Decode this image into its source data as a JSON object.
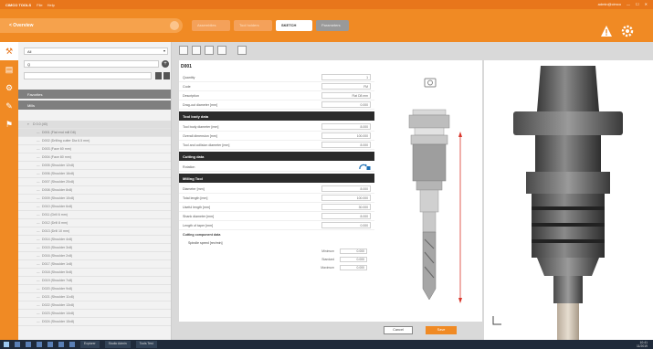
{
  "window": {
    "title": "CIMCO TOOLS",
    "menu": [
      "File",
      "Help"
    ],
    "user": "admin@cimco",
    "controls": [
      "minimize",
      "maximize",
      "close"
    ]
  },
  "header": {
    "back_label": "< Overview",
    "tabs": [
      "Assemblies",
      "Tool holders",
      "SKETCH",
      "Parameters"
    ],
    "icons": [
      "warning-icon",
      "gear-icon"
    ],
    "accent": "#f08a24"
  },
  "left_panel": {
    "filter_value": "All",
    "search_placeholder": "Q",
    "groups": [
      "Favorites",
      "Mills"
    ],
    "tree": [
      {
        "label": "D 0.0 (40)",
        "parent": true,
        "selected": true
      },
      {
        "label": "D001 (Flat end mill D8)",
        "selected": true
      },
      {
        "label": "D002 (Drilling cutter Dia 6.5 mm)"
      },
      {
        "label": "D003 (Face 60 mm)"
      },
      {
        "label": "D004 (Face 80 mm)"
      },
      {
        "label": "D005 (Shoulder 12x8)"
      },
      {
        "label": "D006 (Shoulder 16x8)"
      },
      {
        "label": "D007 (Shoulder 20x8)"
      },
      {
        "label": "D008 (Shoulder 8x8)"
      },
      {
        "label": "D009 (Shoulder 10x8)"
      },
      {
        "label": "D010 (Shoulder 6x8)"
      },
      {
        "label": "D011 (Drill 6 mm)"
      },
      {
        "label": "D012 (Drill 8 mm)"
      },
      {
        "label": "D013 (Drill 10 mm)"
      },
      {
        "label": "D014 (Shoulder 4x8)"
      },
      {
        "label": "D015 (Shoulder 3x8)"
      },
      {
        "label": "D016 (Shoulder 2x8)"
      },
      {
        "label": "D017 (Shoulder 1x8)"
      },
      {
        "label": "D018 (Shoulder 5x8)"
      },
      {
        "label": "D019 (Shoulder 7x8)"
      },
      {
        "label": "D020 (Shoulder 9x8)"
      },
      {
        "label": "D021 (Shoulder 11x8)"
      },
      {
        "label": "D022 (Shoulder 13x8)"
      },
      {
        "label": "D023 (Shoulder 14x8)"
      },
      {
        "label": "D024 (Shoulder 15x8)"
      }
    ]
  },
  "form": {
    "title": "D001",
    "rows_top": [
      {
        "label": "Quantity",
        "value": "1"
      },
      {
        "label": "Code",
        "value": "FM"
      },
      {
        "label": "Description",
        "value": "Flat D8 mm"
      },
      {
        "label": "Drag-out diameter [mm]",
        "value": "0.000"
      }
    ],
    "section_holder": "Tool body data",
    "rows_holder": [
      {
        "label": "Tool body diameter [mm]",
        "value": "8.000"
      },
      {
        "label": "Overall dimension [mm]",
        "value": "100.000"
      },
      {
        "label": "Tool and collision diameter [mm]",
        "value": "8.000"
      }
    ],
    "section_cutting": "Cutting data",
    "rotation_label": "Rotation",
    "section_milling": "Milling Tool",
    "rows_milling": [
      {
        "label": "Diameter [mm]",
        "value": "8.000"
      },
      {
        "label": "Total length [mm]",
        "value": "100.000"
      },
      {
        "label": "Useful length [mm]",
        "value": "30.000"
      },
      {
        "label": "Shank diameter [mm]",
        "value": "8.000"
      },
      {
        "label": "Length of taper [mm]",
        "value": "0.000"
      }
    ],
    "subhead_component": "Cutting component data",
    "subhead_speed": "Spindle speed [rev/min]",
    "rows_speed": [
      {
        "label": "Minimum",
        "value": "0.000"
      },
      {
        "label": "Standard",
        "value": "0.000"
      },
      {
        "label": "Maximum",
        "value": "0.000"
      }
    ]
  },
  "actions": {
    "cancel": "Cancel",
    "save": "Save"
  },
  "taskbar": {
    "apps": [
      "Explorer",
      "Studio Admin",
      "Tools Test"
    ],
    "time": "10:41",
    "date": "11/2019"
  }
}
